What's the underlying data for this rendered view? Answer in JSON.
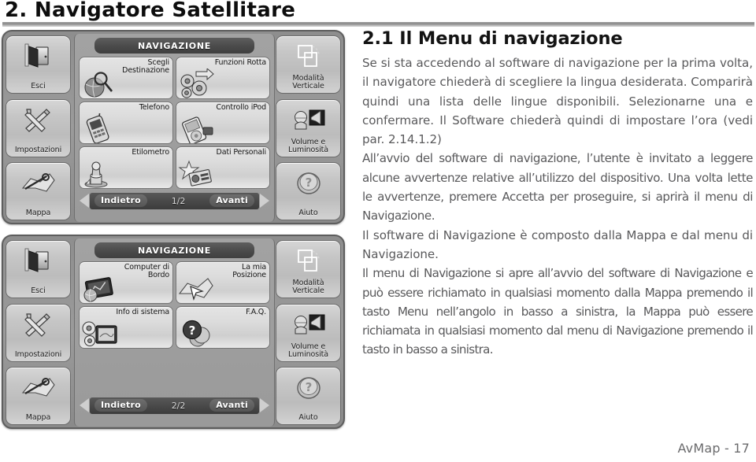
{
  "header": {
    "chapter_title": "2. Navigatore Satellitare"
  },
  "footer": {
    "text": "AvMap - 17"
  },
  "body": {
    "heading": "2.1  Il Menu di navigazione",
    "paragraphs": [
      "Se si sta accedendo al software di navigazione per la prima volta, il navigatore chiederà di scegliere la lingua desiderata. Comparirà quindi una lista delle lingue disponibili. Selezionarne una e confermare. Il Software chiederà quindi di impostare l’ora (vedi par. 2.14.1.2)",
      "All’avvio del software di navigazione, l’utente è invitato a leggere alcune avvertenze relative all’utilizzo del dispositivo. Una volta lette le avvertenze, premere Accetta per proseguire, si aprirà il menu di Navigazione.",
      "Il software di Navigazione è composto dalla Mappa e dal menu di Navigazione.",
      "Il menu di Navigazione si apre all’avvio del software di Navigazione e può essere richiamato in qualsiasi momento dalla Mappa premendo il tasto Menu nell’angolo in basso a sinistra, la Mappa può essere richiamata in qualsiasi momento dal menu di Navigazione premendo il tasto in basso a sinistra."
    ]
  },
  "colors": {
    "screen_bezel": "#5e5e5e",
    "screen_background": "#9b9b9b",
    "titlebar": "#4c4c4c",
    "tile_face": "#dcdcdc",
    "rail_face": "#c6c6c6",
    "body_text": "#59595b",
    "heading_text": "#131313",
    "footer_text": "#6b6b6d"
  },
  "screens": [
    {
      "id": "navigazione-page-1",
      "panel_title": "NAVIGAZIONE",
      "left_rail": [
        {
          "label": "Esci",
          "icon": "exit-door-icon"
        },
        {
          "label": "Impostazioni",
          "icon": "tools-icon"
        },
        {
          "label": "Mappa",
          "icon": "map-icon"
        }
      ],
      "right_rail": [
        {
          "label": "Modalità\nVerticale",
          "icon": "vertical-mode-icon"
        },
        {
          "label": "Volume e\nLuminosità",
          "icon": "volume-brightness-icon"
        },
        {
          "label": "Aiuto",
          "icon": "help-question-icon"
        }
      ],
      "tiles": [
        {
          "label": "Scegli\nDestinazione",
          "icon": "globe-magnifier-icon"
        },
        {
          "label": "Funzioni Rotta",
          "icon": "gears-route-icon"
        },
        {
          "label": "Telefono",
          "icon": "mobile-phone-icon"
        },
        {
          "label": "Controllo iPod",
          "icon": "ipod-icon"
        },
        {
          "label": "Etilometro",
          "icon": "breathalyzer-icon"
        },
        {
          "label": "Dati Personali",
          "icon": "personal-data-icon"
        }
      ],
      "pager": {
        "prev_label": "Indietro",
        "count_label": "1/2",
        "next_label": "Avanti"
      }
    },
    {
      "id": "navigazione-page-2",
      "panel_title": "NAVIGAZIONE",
      "left_rail": [
        {
          "label": "Esci",
          "icon": "exit-door-icon"
        },
        {
          "label": "Impostazioni",
          "icon": "tools-icon"
        },
        {
          "label": "Mappa",
          "icon": "map-icon"
        }
      ],
      "right_rail": [
        {
          "label": "Modalità\nVerticale",
          "icon": "vertical-mode-icon"
        },
        {
          "label": "Volume e\nLuminosità",
          "icon": "volume-brightness-icon"
        },
        {
          "label": "Aiuto",
          "icon": "help-question-icon"
        }
      ],
      "tiles": [
        {
          "label": "Computer di\nBordo",
          "icon": "trip-computer-icon"
        },
        {
          "label": "La mia\nPosizione",
          "icon": "my-position-icon"
        },
        {
          "label": "Info di sistema",
          "icon": "system-info-icon"
        },
        {
          "label": "F.A.Q.",
          "icon": "faq-icon"
        },
        {
          "label": "",
          "icon": ""
        },
        {
          "label": "",
          "icon": ""
        }
      ],
      "pager": {
        "prev_label": "Indietro",
        "count_label": "2/2",
        "next_label": "Avanti"
      }
    }
  ]
}
